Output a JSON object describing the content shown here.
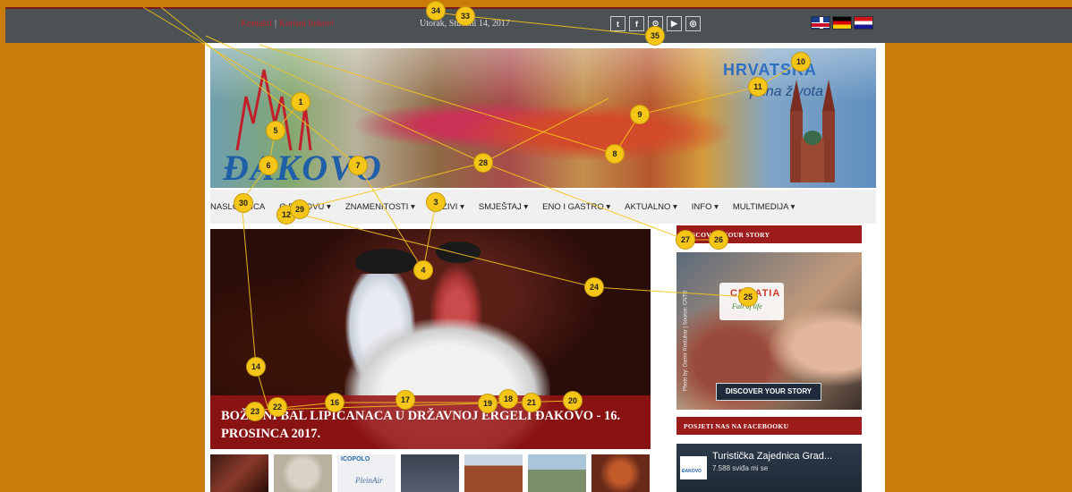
{
  "topbar": {
    "links": [
      "Kontakti",
      "Korisni linkovi"
    ],
    "link_sep": "|",
    "date": "Utorak, Studeni 14, 2017",
    "social": [
      {
        "icon": "twitter-icon",
        "glyph": "t"
      },
      {
        "icon": "facebook-icon",
        "glyph": "f"
      },
      {
        "icon": "pinterest-icon",
        "glyph": "⊙"
      },
      {
        "icon": "youtube-icon",
        "glyph": "▶"
      },
      {
        "icon": "instagram-icon",
        "glyph": "◎"
      }
    ],
    "languages": [
      "english-flag",
      "german-flag",
      "croatian-flag"
    ]
  },
  "banner": {
    "logo": "ĐAKOVO",
    "slogan_1": "HRVATSKA",
    "slogan_2": "puna života"
  },
  "nav": {
    "items": [
      "NASLOVNICA",
      "O ĐAKOVU ▾",
      "ZNAMENITOSTI ▾",
      "DOŽIVI ▾",
      "SMJEŠTAJ ▾",
      "ENO I GASTRO ▾",
      "AKTUALNO ▾",
      "INFO ▾",
      "MULTIMEDIJA ▾"
    ]
  },
  "hero": {
    "caption": "BOŽIĆNI BAL LIPICANACA U DRŽAVNOJ ERGELI ĐAKOVO - 16. PROSINCA 2017."
  },
  "thumbs": {
    "t3_brand": "ICOPOLO",
    "t3_script": "PleinAir"
  },
  "sidebar": {
    "heading_story": "DISCOVER YOUR STORY",
    "promo_brand": "CROATIA",
    "promo_tagline": "Full of life",
    "promo_credit": "Photo by: Damir Rostuhar | Source: CNTB",
    "promo_button": "DISCOVER YOUR STORY",
    "heading_facebook": "POSJETI NAS NA FACEBOOKU",
    "fb_name": "Turistička Zajednica Grad...",
    "fb_likes": "7.588 sviđa mi se",
    "fb_logo": "ĐAKOVO"
  },
  "markers": [
    "1",
    "3",
    "4",
    "5",
    "6",
    "7",
    "8",
    "9",
    "10",
    "11",
    "12",
    "14",
    "16",
    "17",
    "18",
    "19",
    "20",
    "21",
    "22",
    "23",
    "24",
    "25",
    "26",
    "27",
    "28",
    "29",
    "30",
    "33",
    "34",
    "35"
  ]
}
